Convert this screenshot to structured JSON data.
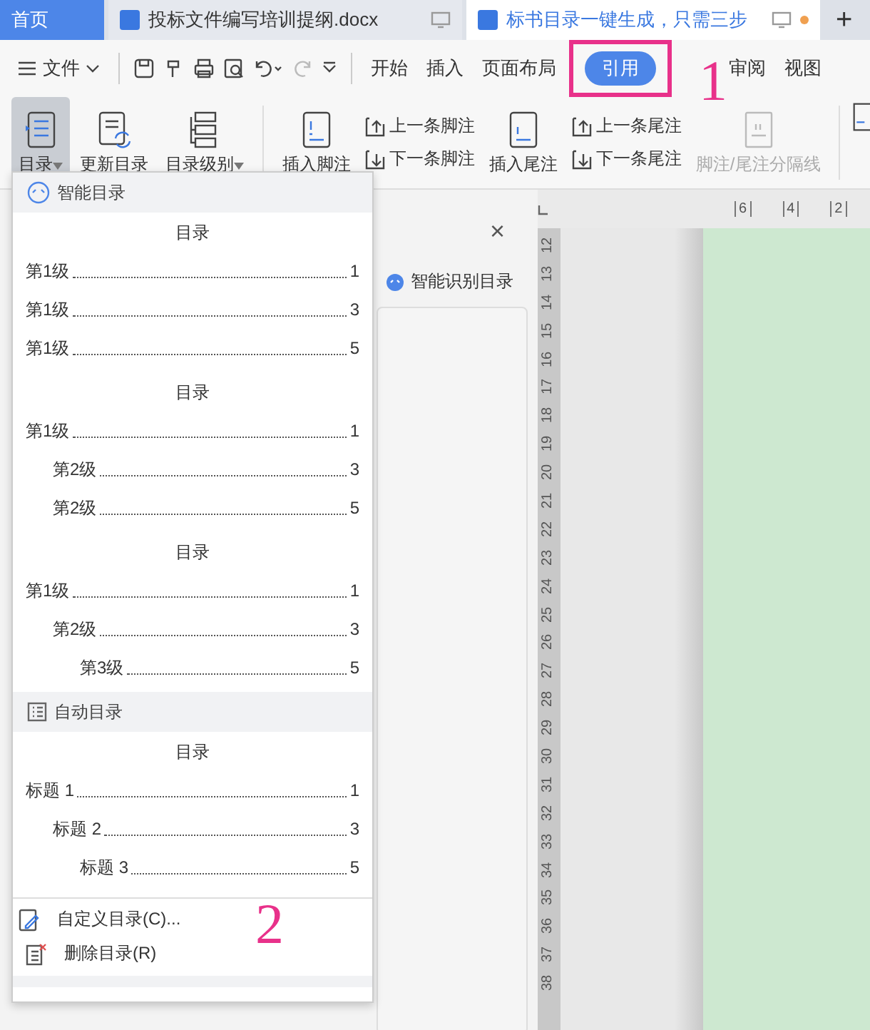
{
  "tabs": [
    {
      "label": "首页",
      "kind": "home",
      "selected": false,
      "unsaved": false
    },
    {
      "label": "投标文件编写培训提纲.docx",
      "kind": "doc",
      "selected": false,
      "unsaved": false
    },
    {
      "label": "标书目录一键生成，只需三步",
      "kind": "doc",
      "selected": true,
      "unsaved": true
    }
  ],
  "new_tab": "+",
  "menu": {
    "file": "文件",
    "tabs": [
      {
        "label": "开始",
        "selected": false
      },
      {
        "label": "插入",
        "selected": false
      },
      {
        "label": "页面布局",
        "selected": false
      },
      {
        "label": "引用",
        "selected": true,
        "annotation": "1"
      },
      {
        "label": "审阅",
        "selected": false
      },
      {
        "label": "视图",
        "selected": false
      }
    ]
  },
  "ribbon": [
    {
      "kind": "large",
      "label": "目录",
      "dropdown": true,
      "selected": true,
      "disabled": false
    },
    {
      "kind": "large",
      "label": "更新目录",
      "dropdown": false,
      "selected": false,
      "disabled": false
    },
    {
      "kind": "large",
      "label": "目录级别",
      "dropdown": true,
      "selected": false,
      "disabled": false
    },
    {
      "kind": "separator"
    },
    {
      "kind": "large",
      "label": "插入脚注",
      "dropdown": false,
      "selected": false,
      "disabled": false
    },
    {
      "kind": "pair",
      "items": [
        {
          "label": "上一条脚注"
        },
        {
          "label": "下一条脚注"
        }
      ]
    },
    {
      "kind": "large",
      "label": "插入尾注",
      "dropdown": false,
      "selected": false,
      "disabled": false
    },
    {
      "kind": "pair",
      "items": [
        {
          "label": "上一条尾注"
        },
        {
          "label": "下一条尾注"
        }
      ]
    },
    {
      "kind": "large",
      "label": "脚注/尾注分隔线",
      "dropdown": false,
      "selected": false,
      "disabled": true
    }
  ],
  "dropdown": {
    "sections": [
      {
        "title": "智能目录",
        "kind": "smart",
        "previews": [
          {
            "heading": "目录",
            "entries": [
              {
                "label": "第1级",
                "page": "1"
              },
              {
                "label": "第1级",
                "page": "3"
              },
              {
                "label": "第1级",
                "page": "5"
              }
            ]
          },
          {
            "heading": "目录",
            "entries": [
              {
                "label": "第1级",
                "page": "1",
                "children": [
                  {
                    "label": "第2级",
                    "page": "3"
                  },
                  {
                    "label": "第2级",
                    "page": "5"
                  }
                ]
              }
            ]
          },
          {
            "heading": "目录",
            "entries": [
              {
                "label": "第1级",
                "page": "1",
                "children": [
                  {
                    "label": "第2级",
                    "page": "3",
                    "children": [
                      {
                        "label": "第3级",
                        "page": "5"
                      }
                    ]
                  }
                ]
              }
            ]
          }
        ]
      },
      {
        "title": "自动目录",
        "kind": "auto",
        "previews": [
          {
            "heading": "目录",
            "entries": [
              {
                "label": "标题 1",
                "page": "1",
                "children": [
                  {
                    "label": "标题 2",
                    "page": "3",
                    "children": [
                      {
                        "label": "标题 3",
                        "page": "5"
                      }
                    ]
                  }
                ]
              }
            ]
          }
        ]
      }
    ],
    "actions": [
      {
        "label": "自定义目录(C)...",
        "annotation": "2"
      },
      {
        "label": "删除目录(R)"
      }
    ]
  },
  "side_pane": {
    "close": "×",
    "title": "智能识别目录"
  },
  "horizontal_ruler": [
    "6",
    "4",
    "2"
  ],
  "vertical_ruler": [
    "12",
    "13",
    "14",
    "15",
    "16",
    "17",
    "18",
    "19",
    "20",
    "21",
    "22",
    "23",
    "24",
    "25",
    "26",
    "27",
    "28",
    "29",
    "30",
    "31",
    "32",
    "33",
    "34",
    "35",
    "36",
    "37",
    "38"
  ]
}
